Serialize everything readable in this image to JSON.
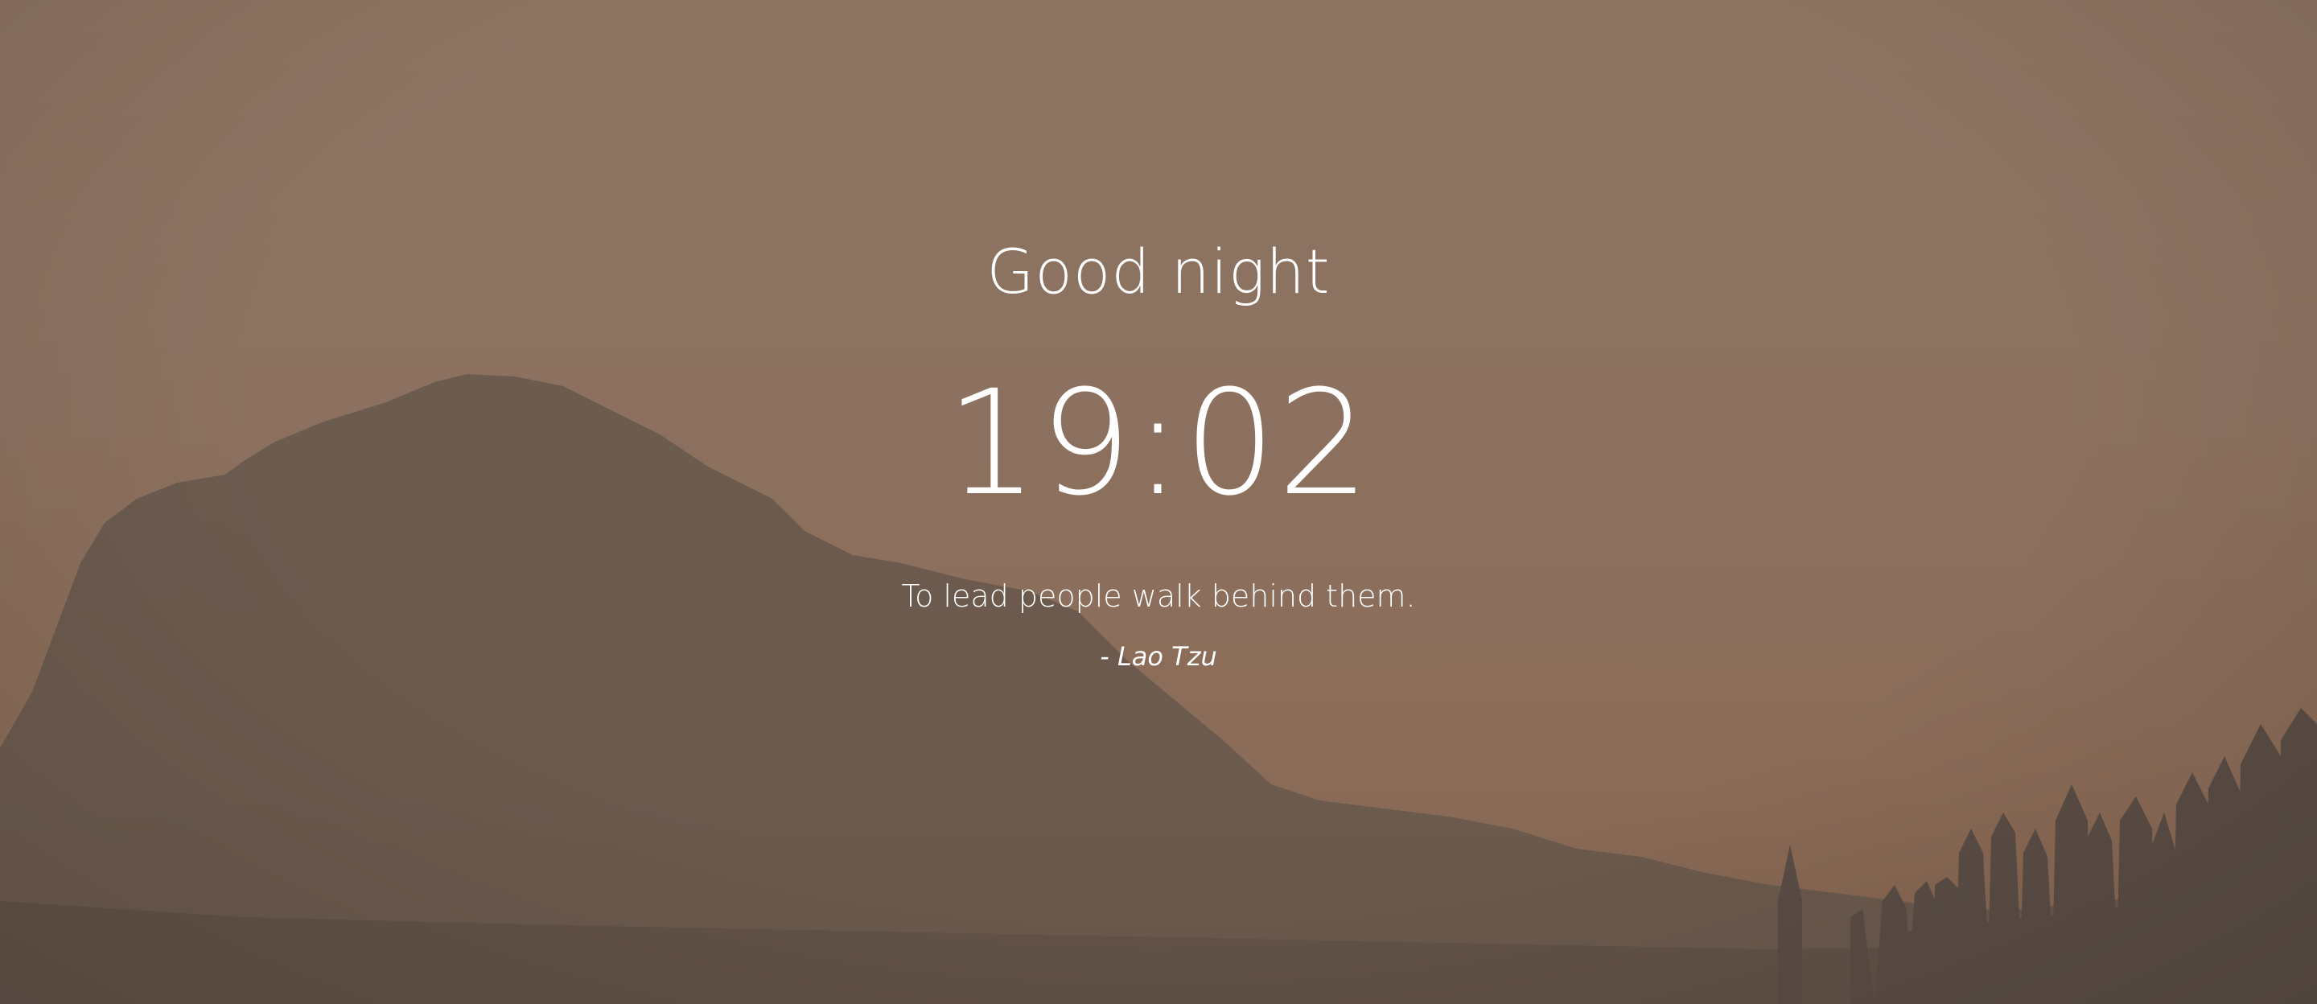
{
  "greeting": "Good night",
  "clock": {
    "time": "19:02"
  },
  "quote": {
    "text": "To lead people walk behind them.",
    "author": "- Lao Tzu"
  },
  "background": {
    "description_icon": "mountain-silhouette",
    "sky_color": "#8d7462",
    "mountain_color": "#66574c",
    "trees_color": "#5a4d45"
  }
}
